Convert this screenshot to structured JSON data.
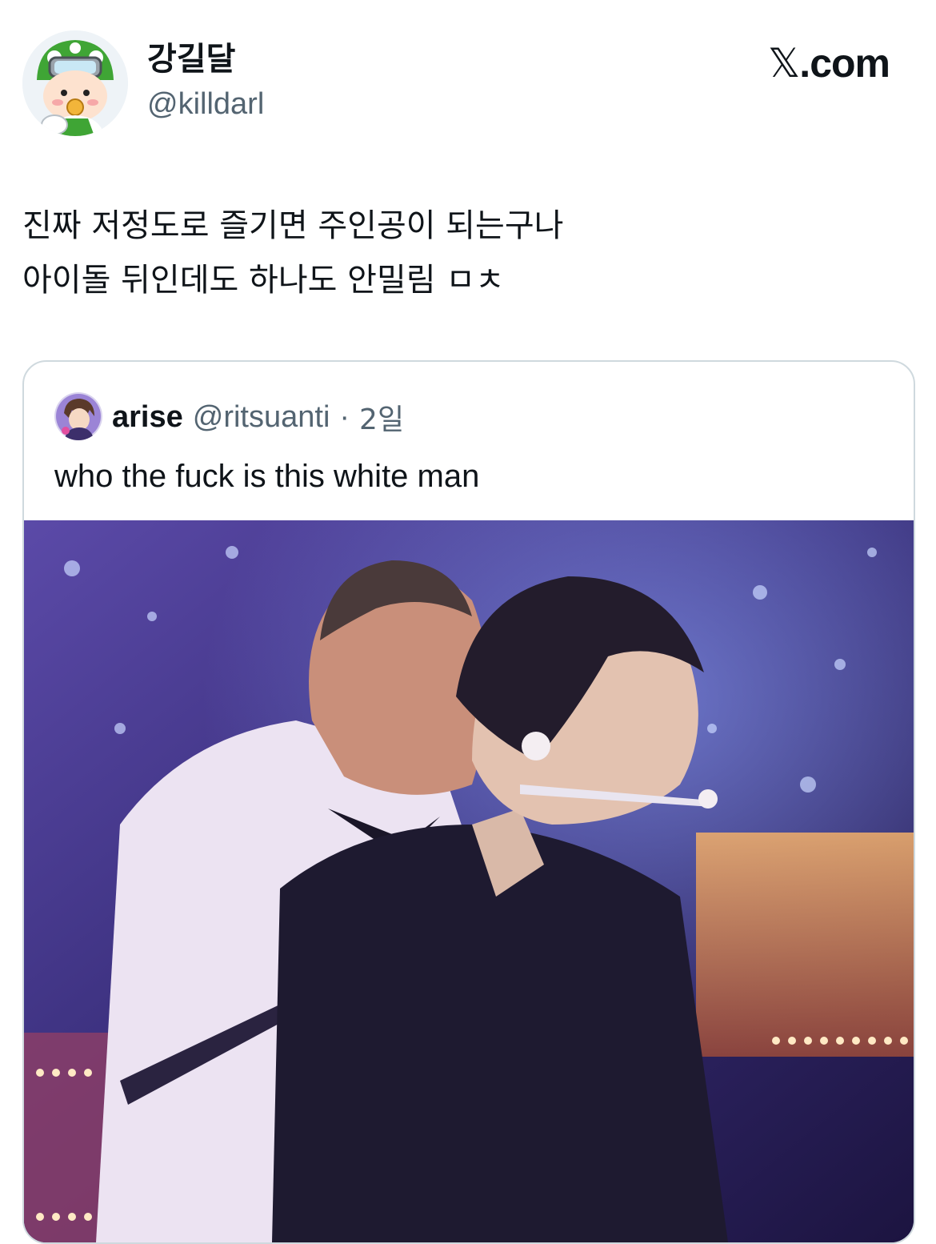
{
  "author": {
    "display_name": "강길달",
    "handle": "@killdarl",
    "avatar_icon": "cartoon-character-avatar"
  },
  "brand": {
    "x_glyph": "𝕏",
    "suffix": ".com"
  },
  "tweet": {
    "lines": [
      "진짜 저정도로 즐기면 주인공이 되는구나",
      "아이돌 뒤인데도 하나도 안밀림 ㅁㅊ"
    ]
  },
  "quoted_tweet": {
    "display_name": "arise",
    "handle": "@ritsuanti",
    "separator": "·",
    "time": "2일",
    "text": "who the fuck is this white man",
    "avatar_icon": "anime-character-avatar",
    "media_icon": "concert-stage-video-still"
  },
  "colors": {
    "text_primary": "#0f1419",
    "text_secondary": "#536471",
    "card_border": "#cfd9de"
  }
}
